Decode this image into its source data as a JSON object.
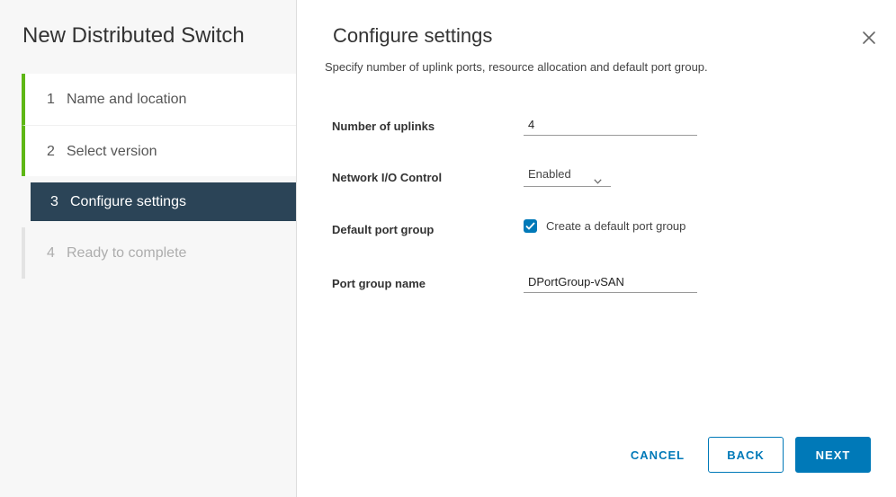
{
  "wizard": {
    "title": "New Distributed Switch",
    "steps": [
      {
        "number": "1",
        "label": "Name and location",
        "state": "done"
      },
      {
        "number": "2",
        "label": "Select version",
        "state": "done"
      },
      {
        "number": "3",
        "label": "Configure settings",
        "state": "active"
      },
      {
        "number": "4",
        "label": "Ready to complete",
        "state": "pending"
      }
    ]
  },
  "page": {
    "title": "Configure settings",
    "subtitle": "Specify number of uplink ports, resource allocation and default port group.",
    "close_icon": "close-icon"
  },
  "form": {
    "uplinks_label": "Number of uplinks",
    "uplinks_value": "4",
    "nioc_label": "Network I/O Control",
    "nioc_value": "Enabled",
    "nioc_icon": "chevron-down-icon",
    "default_pg_label": "Default port group",
    "default_pg_checkbox_label": "Create a default port group",
    "default_pg_checked": true,
    "pg_name_label": "Port group name",
    "pg_name_value": "DPortGroup-vSAN"
  },
  "footer": {
    "cancel_label": "CANCEL",
    "back_label": "BACK",
    "next_label": "NEXT"
  },
  "colors": {
    "accent": "#0079b8",
    "step_done": "#5eb715",
    "step_active_bg": "#2b4457"
  }
}
